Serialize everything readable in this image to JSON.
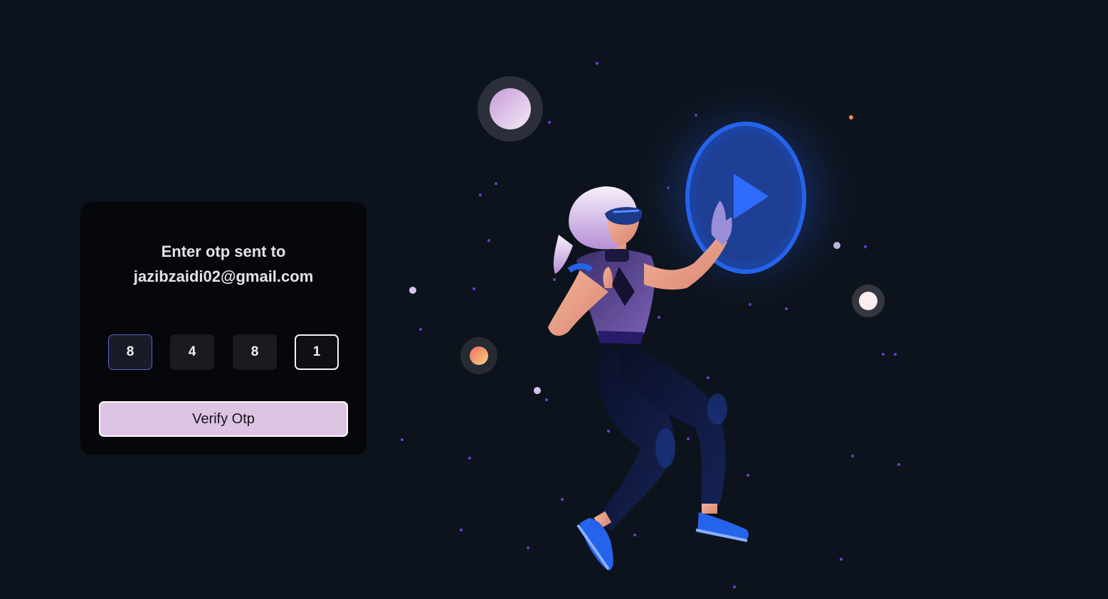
{
  "otp_form": {
    "heading_line1": "Enter otp sent to",
    "heading_line2": "jazibzaidi02@gmail.com",
    "digits": [
      "8",
      "4",
      "8",
      "1"
    ],
    "verify_label": "Verify Otp"
  },
  "colors": {
    "background": "#0d131c",
    "card": "#05070a",
    "button": "#dcc4e3",
    "accent_blue": "#2563eb"
  },
  "illustration": {
    "subject": "woman-with-vr-headset-touching-play-button"
  }
}
